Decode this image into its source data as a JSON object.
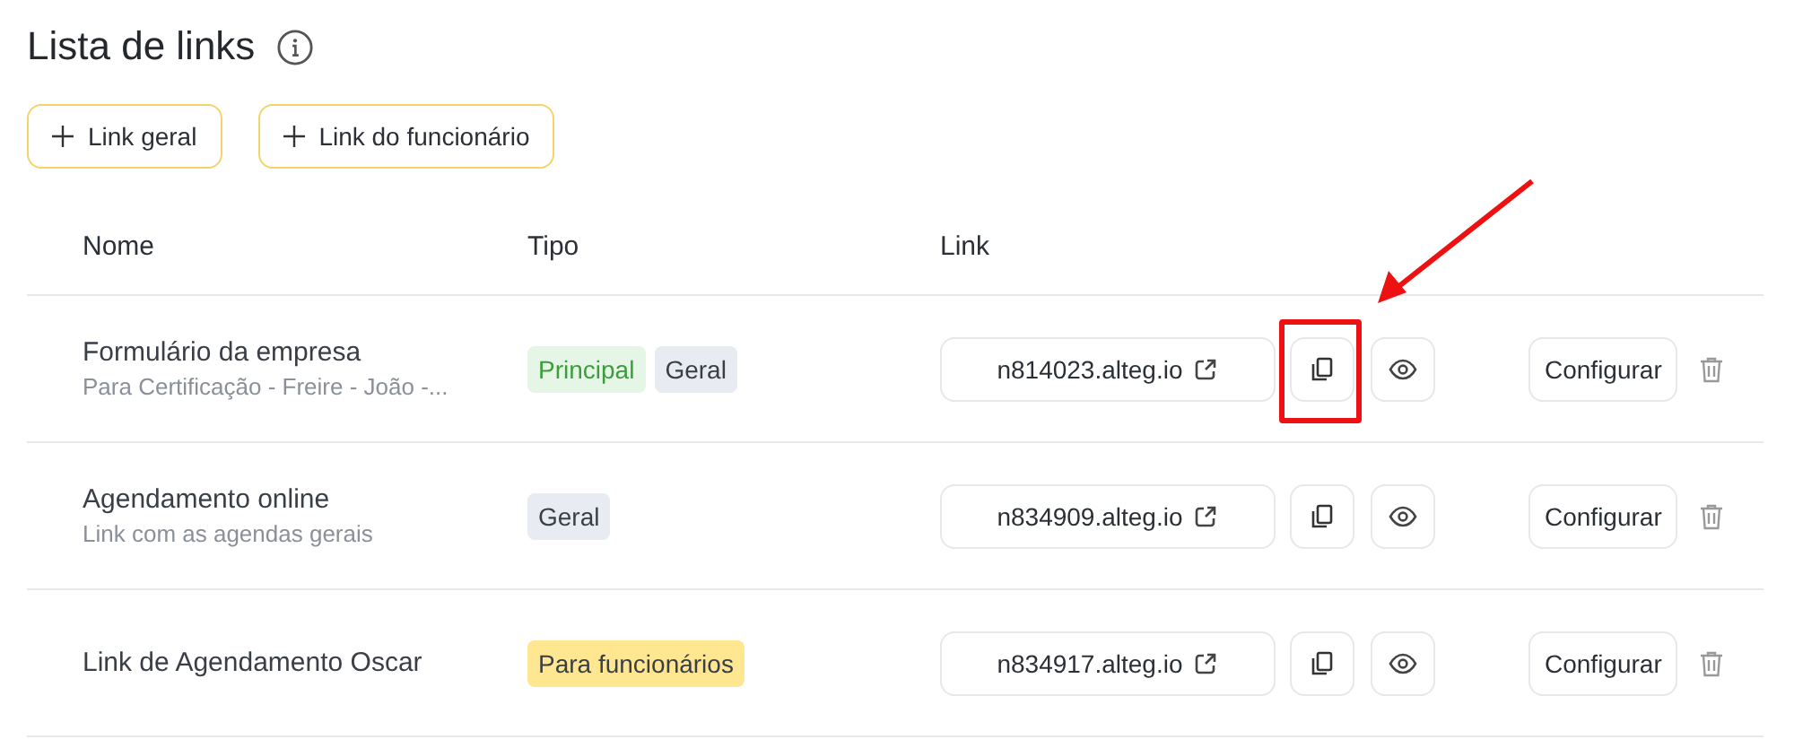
{
  "title": "Lista de links",
  "actions": [
    {
      "label": "Link geral"
    },
    {
      "label": "Link do funcionário"
    }
  ],
  "table": {
    "columns": [
      "Nome",
      "Tipo",
      "Link"
    ],
    "rows": [
      {
        "name": "Formulário da empresa",
        "description": "Para Certificação - Freire - João -...",
        "tags": [
          {
            "label": "Principal",
            "kind": "main"
          },
          {
            "label": "Geral",
            "kind": "general"
          }
        ],
        "link": "n814023.alteg.io",
        "action": "Configurar",
        "highlighted": true
      },
      {
        "name": "Agendamento online",
        "description": "Link com as agendas gerais",
        "tags": [
          {
            "label": "Geral",
            "kind": "general"
          }
        ],
        "link": "n834909.alteg.io",
        "action": "Configurar",
        "highlighted": false
      },
      {
        "name": "Link de Agendamento Oscar",
        "tags": [
          {
            "label": "Para funcionários",
            "kind": "staff"
          }
        ],
        "link": "n834917.alteg.io",
        "action": "Configurar",
        "highlighted": false
      }
    ]
  }
}
